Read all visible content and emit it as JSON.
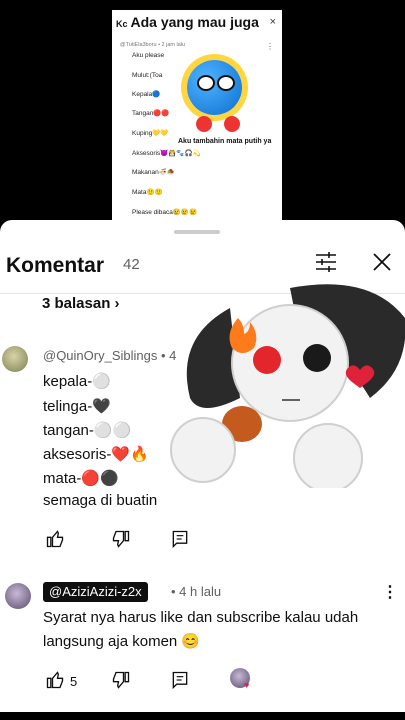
{
  "video": {
    "title_prefix": "Kc",
    "title": "Ada yang mau juga",
    "close": "×",
    "user": "@TutiEla3boru • 2 jam lalu",
    "more": "⋮",
    "lines": [
      "Aku please",
      "Mulut:(Toa",
      "Kepala🔵",
      "Tangan🔴🔴",
      "Kuping💛💛",
      "Aksesoris😈👸🏻🐾🎧💫",
      "Makanan🍜🧆",
      "Mata🙂🙂",
      "Please dibaca😢😢😢"
    ],
    "caption": "Aku tambahin mata putih ya"
  },
  "header": {
    "title": "Komentar",
    "count": "42"
  },
  "replies_label": "3 balasan ›",
  "comment1": {
    "user": "@QuinOry_Siblings",
    "time": "• 4",
    "lines": [
      "kepala-⚪",
      "telinga-🖤",
      "tangan-⚪⚪",
      "aksesoris-❤️🔥",
      "mata-🔴⚫",
      "semaga di buatin"
    ]
  },
  "comment2": {
    "user": "@AziziAzizi-z2x",
    "time": "• 4 h lalu",
    "text": "Syarat nya harus like dan subscribe kalau udah langsung aja komen 😊",
    "likes": "5",
    "more": "⋮"
  },
  "colors": {
    "text": "#0f0f0f",
    "secondary": "#606060",
    "heart": "#e0213a"
  }
}
